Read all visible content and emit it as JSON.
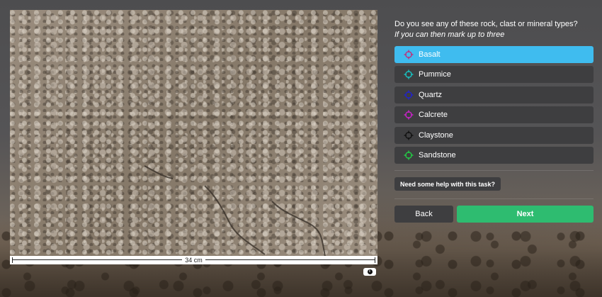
{
  "subject": {
    "scale_label": "34 cm",
    "info_icon": "info-icon"
  },
  "task": {
    "question": "Do you see any of these rock, clast or mineral types?",
    "instruction": "If you can then mark up to three",
    "choices": [
      {
        "label": "Basalt",
        "color": "#c0307a",
        "selected": true,
        "icon": "crosshair-icon"
      },
      {
        "label": "Pummice",
        "color": "#16c2c2",
        "selected": false,
        "icon": "crosshair-icon"
      },
      {
        "label": "Quartz",
        "color": "#2222cc",
        "selected": false,
        "icon": "crosshair-icon"
      },
      {
        "label": "Calcrete",
        "color": "#cc22cc",
        "selected": false,
        "icon": "crosshair-icon"
      },
      {
        "label": "Claystone",
        "color": "#111111",
        "selected": false,
        "icon": "crosshair-icon"
      },
      {
        "label": "Sandstone",
        "color": "#22cc44",
        "selected": false,
        "icon": "crosshair-icon"
      }
    ],
    "help_label": "Need some help with this task?",
    "back_label": "Back",
    "next_label": "Next"
  },
  "colors": {
    "selected": "#3fbcef",
    "button": "#3e3e40",
    "next": "#2ebc70"
  }
}
